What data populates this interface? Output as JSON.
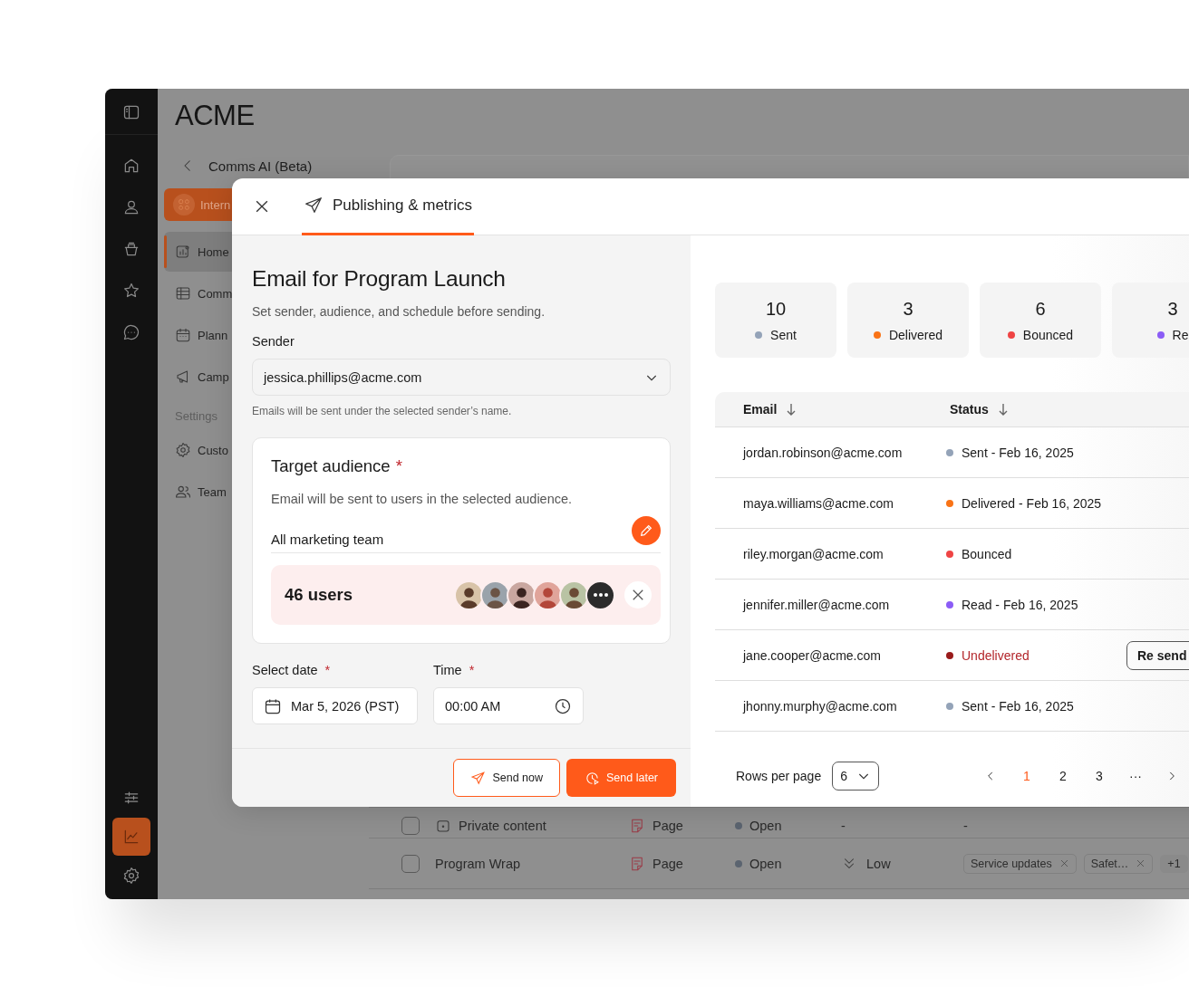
{
  "app": {
    "logo": "ACME",
    "back_label": "Comms AI (Beta)"
  },
  "rail": {
    "top": [
      {
        "selected": false
      },
      {
        "selected": false
      },
      {
        "selected": false
      },
      {
        "selected": false
      },
      {
        "selected": false
      }
    ],
    "bottom": [
      {
        "selected": false
      },
      {
        "selected": true
      },
      {
        "selected": false
      }
    ]
  },
  "sidebar": {
    "items": [
      {
        "kind": "action",
        "label": "Intern"
      },
      {
        "kind": "nav",
        "label": "Home",
        "selected": true
      },
      {
        "kind": "nav",
        "label": "Comm",
        "selected": false
      },
      {
        "kind": "nav",
        "label": "Plann",
        "selected": false
      },
      {
        "kind": "nav",
        "label": "Camp",
        "selected": false
      },
      {
        "kind": "heading",
        "label": "Settings"
      },
      {
        "kind": "nav",
        "label": "Custo",
        "selected": false
      },
      {
        "kind": "nav",
        "label": "Team",
        "selected": false
      }
    ]
  },
  "background_table": {
    "rows": [
      {
        "checked": false,
        "title": "Private content",
        "type": "Page",
        "status": "Open",
        "priority": "-",
        "priority_icon": false,
        "tags_text": "-"
      },
      {
        "checked": false,
        "title": "Program Wrap",
        "type": "Page",
        "status": "Open",
        "priority": "Low",
        "priority_icon": true,
        "tags": [
          "Service updates",
          "Safet…"
        ],
        "tags_more": "+1"
      }
    ]
  },
  "modal": {
    "tabs": [
      {
        "label": "Publishing & metrics",
        "selected": true
      }
    ],
    "form": {
      "title": "Email for Program Launch",
      "subtitle": "Set sender, audience, and schedule before sending.",
      "sender_label": "Sender",
      "sender_value": "jessica.phillips@acme.com",
      "sender_hint": "Emails will be sent under the selected sender’s name.",
      "audience": {
        "title": "Target audience",
        "required_mark": "*",
        "description": "Email will be sent to users in the selected audience.",
        "selected": "All marketing team",
        "count": "46 users",
        "avatars": [
          {
            "kind": "person"
          },
          {
            "kind": "person"
          },
          {
            "kind": "person"
          },
          {
            "kind": "person"
          },
          {
            "kind": "person"
          },
          {
            "kind": "more"
          }
        ]
      },
      "date": {
        "label": "Select date",
        "required_mark": "*",
        "value": "Mar 5, 2026 (PST)"
      },
      "time": {
        "label": "Time",
        "required_mark": "*",
        "value": "00:00 AM"
      },
      "buttons": [
        {
          "label": "Send now",
          "kind": "secondary"
        },
        {
          "label": "Send later",
          "kind": "primary"
        }
      ]
    },
    "metrics": {
      "stats": [
        {
          "value": "10",
          "label": "Sent",
          "color": "#94a3b8"
        },
        {
          "value": "3",
          "label": "Delivered",
          "color": "#f97316"
        },
        {
          "value": "6",
          "label": "Bounced",
          "color": "#ef4444"
        },
        {
          "value": "3",
          "label": "Re",
          "color": "#8b5cf6"
        }
      ],
      "columns": [
        {
          "label": "Email",
          "sorted": true
        },
        {
          "label": "Status",
          "sorted": true
        }
      ],
      "rows": [
        {
          "email": "jordan.robinson@acme.com",
          "status": "Sent - Feb 16, 2025",
          "color": "#94a3b8",
          "alert": false
        },
        {
          "email": "maya.williams@acme.com",
          "status": "Delivered - Feb 16, 2025",
          "color": "#f97316",
          "alert": false
        },
        {
          "email": "riley.morgan@acme.com",
          "status": "Bounced",
          "color": "#ef4444",
          "alert": false
        },
        {
          "email": "jennifer.miller@acme.com",
          "status": "Read - Feb 16, 2025",
          "color": "#8b5cf6",
          "alert": false
        },
        {
          "email": "jane.cooper@acme.com",
          "status": "Undelivered",
          "color": "#991b1b",
          "alert": true,
          "action": "Re send"
        },
        {
          "email": "jhonny.murphy@acme.com",
          "status": "Sent - Feb 16, 2025",
          "color": "#94a3b8",
          "alert": false
        }
      ],
      "pagination": {
        "label": "Rows per page",
        "value": "6",
        "pages": [
          {
            "label": "1",
            "selected": true
          },
          {
            "label": "2",
            "selected": false
          },
          {
            "label": "3",
            "selected": false
          }
        ],
        "ellipsis": "···"
      }
    }
  }
}
